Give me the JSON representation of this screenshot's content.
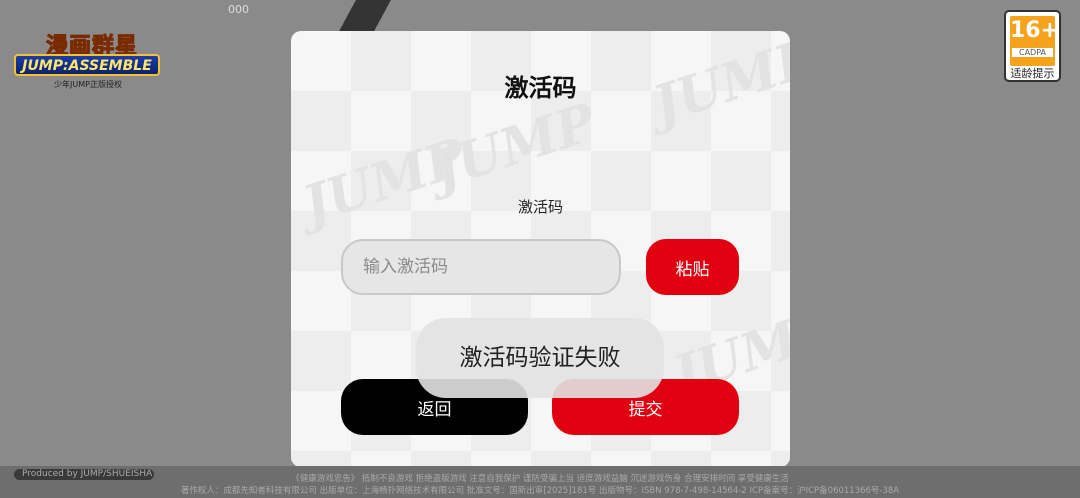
{
  "background": {
    "corner_number": "000"
  },
  "logo": {
    "title_text": "漫画群星",
    "main_text": "JUMP:ASSEMBLE",
    "sub_text": "少年JUMP正版授权"
  },
  "age_rating": {
    "number": "16+",
    "org": "CADPA",
    "label": "适龄提示"
  },
  "dialog": {
    "title": "激活码",
    "field_label": "激活码",
    "input_placeholder": "输入激活码",
    "input_value": "",
    "paste_label": "粘贴",
    "back_label": "返回",
    "submit_label": "提交",
    "watermark": "JUMP"
  },
  "toast": {
    "message": "激活码验证失败"
  },
  "footer": {
    "producer": "Produced by JUMP/SHUEISHA",
    "line1": "《健康游戏忠告》 抵制不良游戏 拒绝盗版游戏 注意自我保护 谨防受骗上当 适度游戏益脑 沉迷游戏伤身 合理安排时间 享受健康生活",
    "line2": "著作权人：成都先知者科技有限公司 出版单位：上海畅扑网络技术有限公司 批准文号：国新出审[2025]181号 出版物号：ISBN 978-7-498-14564-2 ICP备案号：沪ICP备06011366号-38A"
  },
  "colors": {
    "accent_red": "#e0000f",
    "dark_button": "#000000",
    "age_orange": "#f5a21c"
  }
}
